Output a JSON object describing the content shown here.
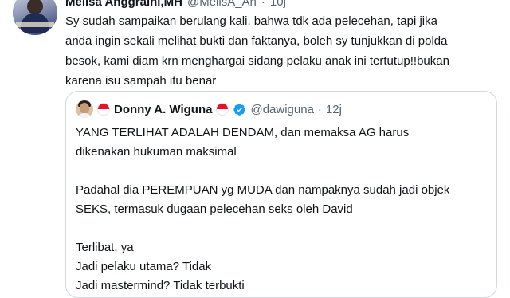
{
  "tweet": {
    "author_name": "Melisa Anggraini,MH",
    "handle": "@MelisA_Ah",
    "separator": "·",
    "time": "10j",
    "text_lines": [
      "Sy sudah sampaikan berulang kali, bahwa tdk ada pelecehan, tapi jika",
      "anda ingin sekali melihat bukti dan faktanya, boleh sy tunjukkan di polda",
      "besok, kami diam krn menghargai sidang pelaku anak ini tertutup!!bukan",
      "karena isu sampah itu benar"
    ]
  },
  "quoted": {
    "author_name": "Donny A. Wiguna",
    "handle": "@dawiguna",
    "separator": "·",
    "time": "12j",
    "flag_colors": {
      "top": "#e8112d",
      "bottom": "#ffffff"
    },
    "verified_color": "#1d9bf0",
    "text_lines": [
      "YANG TERLIHAT ADALAH DENDAM, dan memaksa AG harus",
      "dikenakan hukuman maksimal",
      "",
      "Padahal dia PEREMPUAN yg MUDA dan nampaknya sudah jadi objek",
      "SEKS, termasuk dugaan pelecehan seks oleh David",
      "",
      "Terlibat, ya",
      "Jadi pelaku utama? Tidak",
      "Jadi mastermind? Tidak terbukti"
    ]
  },
  "icons": {
    "quoted_flag_left": "indonesia-flag-icon",
    "quoted_flag_right": "indonesia-flag-icon",
    "verified": "verified-badge-icon"
  }
}
